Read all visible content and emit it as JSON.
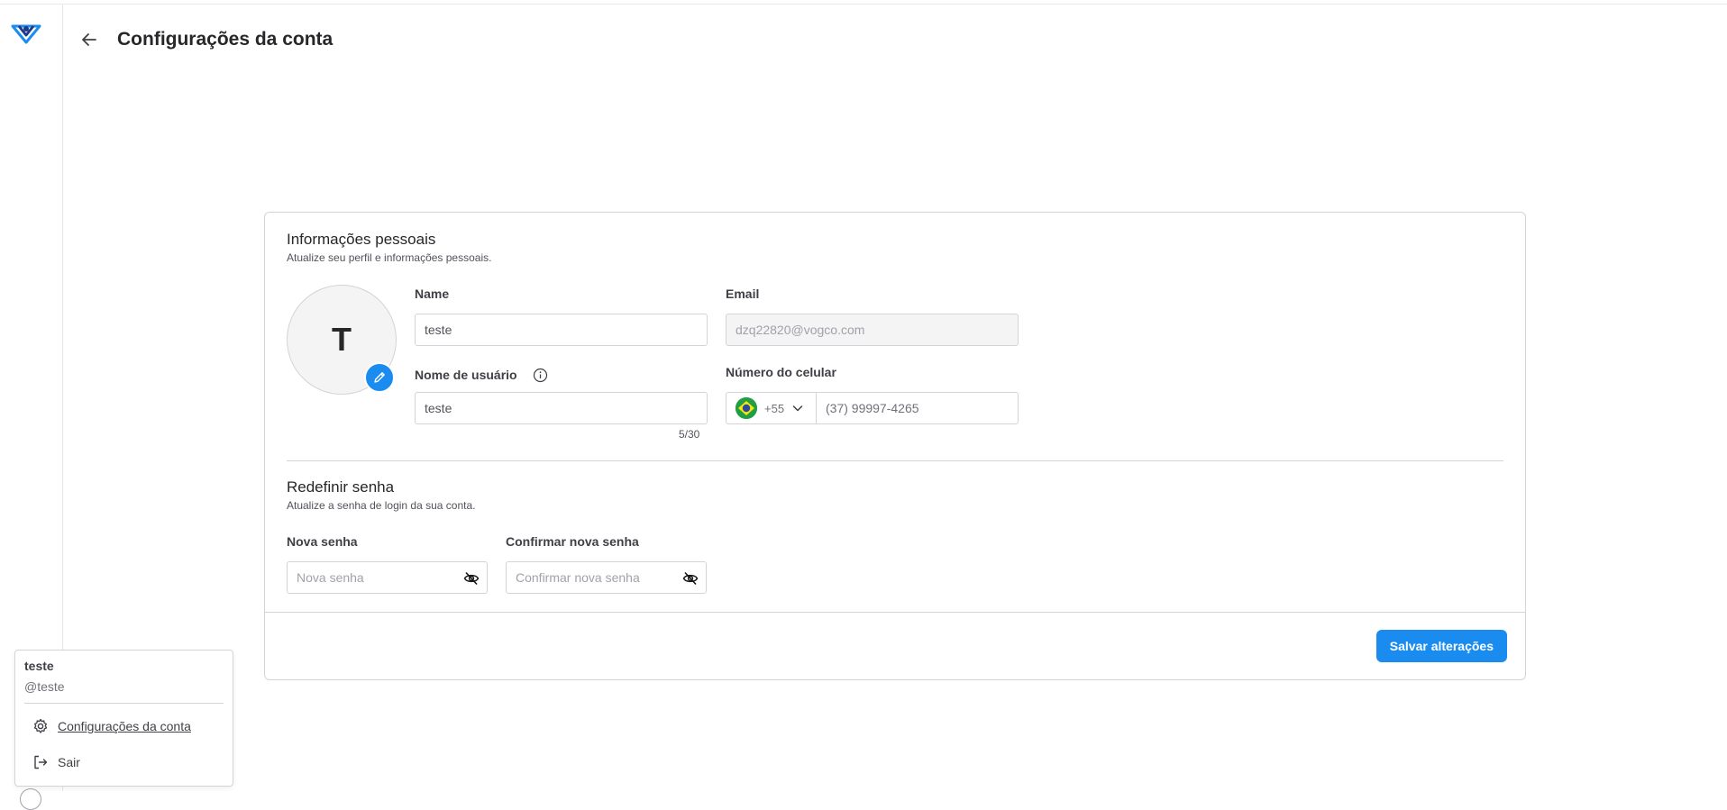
{
  "header": {
    "title": "Configurações da conta"
  },
  "personal": {
    "title": "Informações pessoais",
    "subtitle": "Atualize seu perfil e informações pessoais.",
    "avatar_initial": "T",
    "name_label": "Name",
    "name_value": "teste",
    "email_label": "Email",
    "email_value": "dzq22820@vogco.com",
    "username_label": "Nome de usuário",
    "username_value": "teste",
    "username_counter": "5/30",
    "phone_label": "Número do celular",
    "phone_country_code": "+55",
    "phone_value": "(37) 99997-4265"
  },
  "password": {
    "title": "Redefinir senha",
    "subtitle": "Atualize a senha de login da sua conta.",
    "new_label": "Nova senha",
    "new_placeholder": "Nova senha",
    "confirm_label": "Confirmar nova senha",
    "confirm_placeholder": "Confirmar nova senha"
  },
  "actions": {
    "save_label": "Salvar alterações"
  },
  "user_menu": {
    "name": "teste",
    "handle": "@teste",
    "settings_label": "Configurações da conta",
    "logout_label": "Sair"
  },
  "colors": {
    "accent": "#1a8cf0",
    "border": "#d4d4d8"
  }
}
